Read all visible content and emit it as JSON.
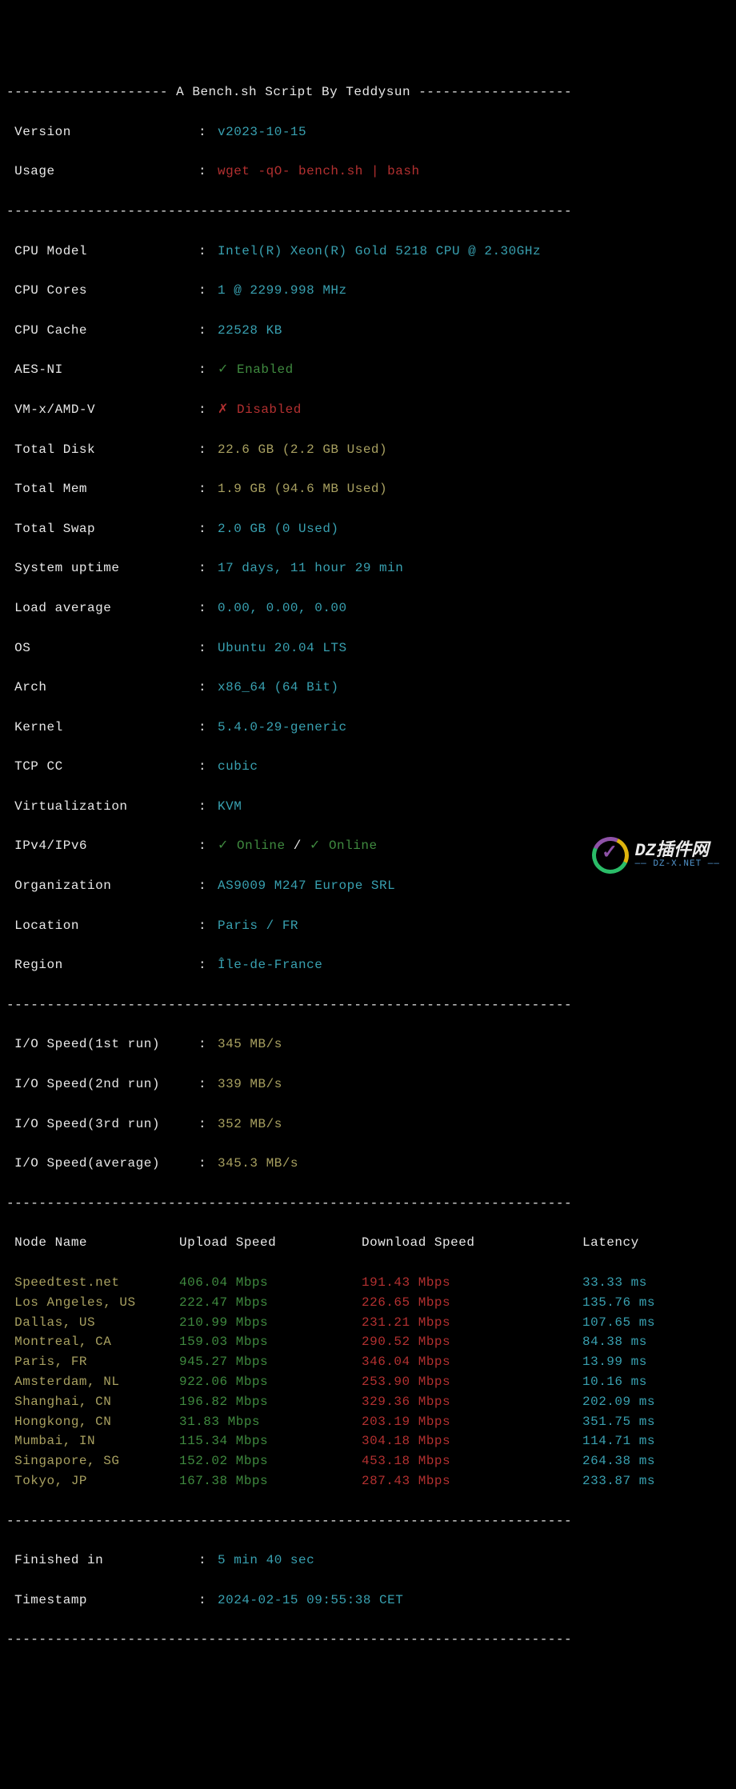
{
  "title_prefix": "-------------------- ",
  "title_text": "A Bench.sh Script By Teddysun",
  "title_suffix": " -------------------",
  "sep_line": "----------------------------------------------------------------------",
  "header": {
    "version_label": " Version",
    "version_value": "v2023-10-15",
    "usage_label": " Usage",
    "usage_value": "wget -qO- bench.sh | bash"
  },
  "sys": {
    "cpu_model_label": " CPU Model",
    "cpu_model_value": "Intel(R) Xeon(R) Gold 5218 CPU @ 2.30GHz",
    "cpu_cores_label": " CPU Cores",
    "cpu_cores_value": "1 @ 2299.998 MHz",
    "cpu_cache_label": " CPU Cache",
    "cpu_cache_value": "22528 KB",
    "aesni_label": " AES-NI",
    "aesni_mark": "✓ ",
    "aesni_value": "Enabled",
    "vmx_label": " VM-x/AMD-V",
    "vmx_mark": "✗ ",
    "vmx_value": "Disabled",
    "total_disk_label": " Total Disk",
    "total_disk_value": "22.6 GB (2.2 GB Used)",
    "total_mem_label": " Total Mem",
    "total_mem_value": "1.9 GB (94.6 MB Used)",
    "total_swap_label": " Total Swap",
    "total_swap_value": "2.0 GB (0 Used)",
    "uptime_label": " System uptime",
    "uptime_value": "17 days, 11 hour 29 min",
    "load_label": " Load average",
    "load_value": "0.00, 0.00, 0.00",
    "os_label": " OS",
    "os_value": "Ubuntu 20.04 LTS",
    "arch_label": " Arch",
    "arch_value": "x86_64 (64 Bit)",
    "kernel_label": " Kernel",
    "kernel_value": "5.4.0-29-generic",
    "tcp_label": " TCP CC",
    "tcp_value": "cubic",
    "virt_label": " Virtualization",
    "virt_value": "KVM",
    "ip_label": " IPv4/IPv6",
    "ip_online1_mark": "✓ ",
    "ip_online1": "Online",
    "ip_sep": " / ",
    "ip_online2_mark": "✓ ",
    "ip_online2": "Online",
    "org_label": " Organization",
    "org_value": "AS9009 M247 Europe SRL",
    "loc_label": " Location",
    "loc_value": "Paris / FR",
    "region_label": " Region",
    "region_value": "Île-de-France"
  },
  "io": {
    "r1_label": " I/O Speed(1st run)",
    "r1_value": "345 MB/s",
    "r2_label": " I/O Speed(2nd run)",
    "r2_value": "339 MB/s",
    "r3_label": " I/O Speed(3rd run)",
    "r3_value": "352 MB/s",
    "avg_label": " I/O Speed(average)",
    "avg_value": "345.3 MB/s"
  },
  "speedtest": {
    "head_node": " Node Name",
    "head_up": "Upload Speed",
    "head_down": "Download Speed",
    "head_lat": "Latency",
    "rows": [
      {
        "node": " Speedtest.net",
        "up": "406.04 Mbps",
        "down": "191.43 Mbps",
        "lat": "33.33 ms"
      },
      {
        "node": " Los Angeles, US",
        "up": "222.47 Mbps",
        "down": "226.65 Mbps",
        "lat": "135.76 ms"
      },
      {
        "node": " Dallas, US",
        "up": "210.99 Mbps",
        "down": "231.21 Mbps",
        "lat": "107.65 ms"
      },
      {
        "node": " Montreal, CA",
        "up": "159.03 Mbps",
        "down": "290.52 Mbps",
        "lat": "84.38 ms"
      },
      {
        "node": " Paris, FR",
        "up": "945.27 Mbps",
        "down": "346.04 Mbps",
        "lat": "13.99 ms"
      },
      {
        "node": " Amsterdam, NL",
        "up": "922.06 Mbps",
        "down": "253.90 Mbps",
        "lat": "10.16 ms"
      },
      {
        "node": " Shanghai, CN",
        "up": "196.82 Mbps",
        "down": "329.36 Mbps",
        "lat": "202.09 ms"
      },
      {
        "node": " Hongkong, CN",
        "up": "31.83 Mbps",
        "down": "203.19 Mbps",
        "lat": "351.75 ms"
      },
      {
        "node": " Mumbai, IN",
        "up": "115.34 Mbps",
        "down": "304.18 Mbps",
        "lat": "114.71 ms"
      },
      {
        "node": " Singapore, SG",
        "up": "152.02 Mbps",
        "down": "453.18 Mbps",
        "lat": "264.38 ms"
      },
      {
        "node": " Tokyo, JP",
        "up": "167.38 Mbps",
        "down": "287.43 Mbps",
        "lat": "233.87 ms"
      }
    ]
  },
  "footer": {
    "finished_label": " Finished in",
    "finished_value": "5 min 40 sec",
    "ts_label": " Timestamp",
    "ts_value": "2024-02-15 09:55:38 CET"
  },
  "watermark": {
    "main": "DZ插件网",
    "sub": "—— DZ-X.NET ——"
  }
}
